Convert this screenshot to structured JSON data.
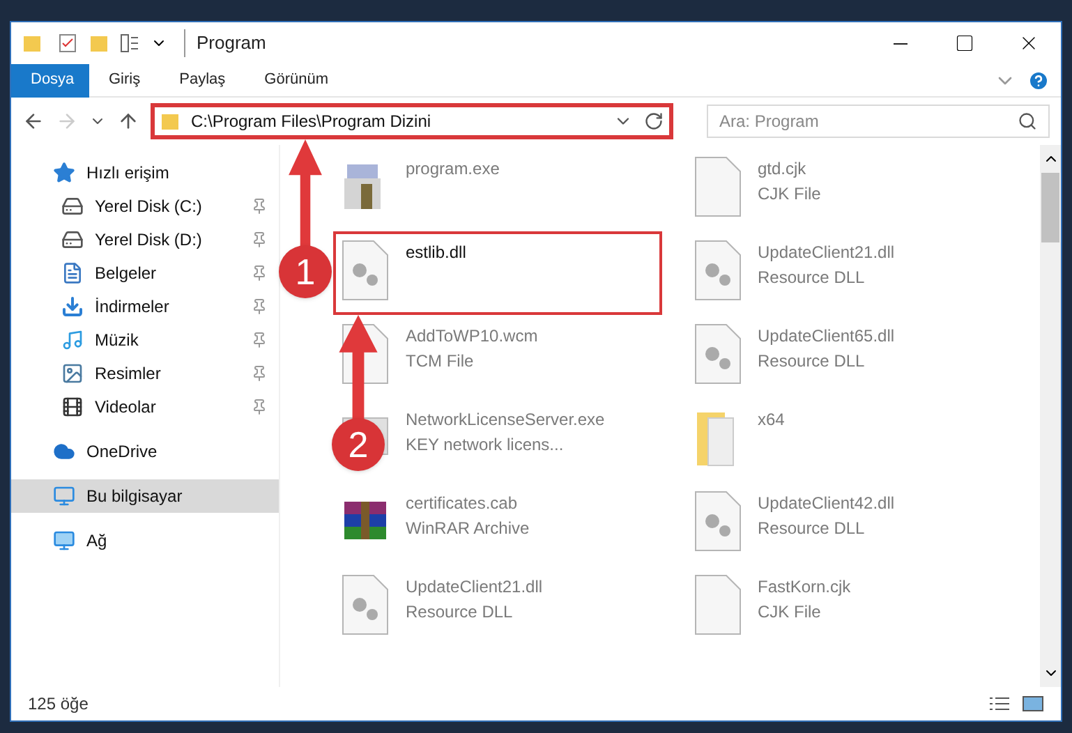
{
  "window": {
    "title": "Program"
  },
  "ribbon_tabs": [
    {
      "label": "Dosya",
      "selected": true
    },
    {
      "label": "Giriş",
      "selected": false
    },
    {
      "label": "Paylaş",
      "selected": false
    },
    {
      "label": "Görünüm",
      "selected": false
    }
  ],
  "address": {
    "path": "C:\\Program Files\\Program Dizini",
    "highlighted": true
  },
  "search": {
    "placeholder": "Ara: Program"
  },
  "sidebar": {
    "items": [
      {
        "label": "Hızlı erişim",
        "kind": "quick",
        "pinned": false,
        "selected": false,
        "children": [
          {
            "label": "Yerel Disk (C:)",
            "kind": "disk-c",
            "pinned": true,
            "selected": false
          },
          {
            "label": "Yerel Disk (D:)",
            "kind": "disk",
            "pinned": true,
            "selected": false
          },
          {
            "label": "Belgeler",
            "kind": "docs",
            "pinned": true,
            "selected": false
          },
          {
            "label": "İndirmeler",
            "kind": "download",
            "pinned": true,
            "selected": false
          },
          {
            "label": "Müzik",
            "kind": "music",
            "pinned": true,
            "selected": false
          },
          {
            "label": "Resimler",
            "kind": "pictures",
            "pinned": true,
            "selected": false
          },
          {
            "label": "Videolar",
            "kind": "videos",
            "pinned": true,
            "selected": false
          }
        ]
      },
      {
        "label": "OneDrive",
        "kind": "cloud",
        "pinned": false,
        "selected": false
      },
      {
        "label": "Bu bilgisayar",
        "kind": "pc",
        "pinned": false,
        "selected": true
      },
      {
        "label": "Ağ",
        "kind": "network",
        "pinned": false,
        "selected": false
      }
    ]
  },
  "files": [
    {
      "name": "program.exe",
      "kind": "exe",
      "blurred": true,
      "highlighted": false
    },
    {
      "name": "gtd.cjk",
      "type": "CJK File",
      "kind": "blank",
      "blurred": true,
      "highlighted": false
    },
    {
      "name": "estlib.dll",
      "kind": "dll",
      "blurred": false,
      "highlighted": true
    },
    {
      "name": "UpdateClient21.dll",
      "type": "Resource DLL",
      "kind": "dll",
      "blurred": true,
      "highlighted": false
    },
    {
      "name": "AddToWP10.wcm",
      "type": "TCM File",
      "kind": "blank",
      "blurred": true,
      "highlighted": false
    },
    {
      "name": "UpdateClient65.dll",
      "type": "Resource DLL",
      "kind": "dll",
      "blurred": true,
      "highlighted": false
    },
    {
      "name": "NetworkLicenseServer.exe",
      "type": "KEY network licens...",
      "kind": "app",
      "blurred": true,
      "highlighted": false
    },
    {
      "name": "x64",
      "kind": "folder",
      "blurred": true,
      "highlighted": false
    },
    {
      "name": "certificates.cab",
      "type": "WinRAR Archive",
      "kind": "archive",
      "blurred": true,
      "highlighted": false
    },
    {
      "name": "UpdateClient42.dll",
      "type": "Resource DLL",
      "kind": "dll",
      "blurred": true,
      "highlighted": false
    },
    {
      "name": "UpdateClient21.dll",
      "type": "Resource DLL",
      "kind": "dll",
      "blurred": true,
      "highlighted": false
    },
    {
      "name": "FastKorn.cjk",
      "type": "CJK File",
      "kind": "blank",
      "blurred": true,
      "highlighted": false
    }
  ],
  "annotations": [
    {
      "label": "1"
    },
    {
      "label": "2"
    }
  ],
  "status_bar": {
    "count": "125 öğe"
  }
}
